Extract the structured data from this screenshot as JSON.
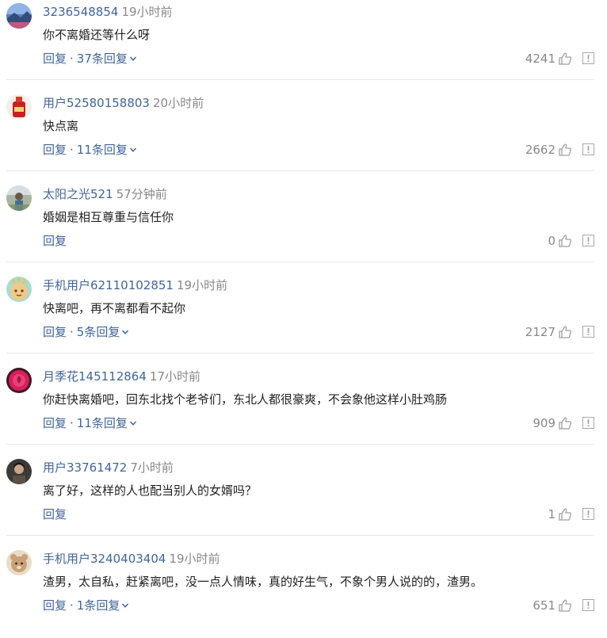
{
  "comments": [
    {
      "username": "3236548854",
      "time": "19小时前",
      "content": "你不离婚还等什么呀",
      "reply_label": "回复",
      "replies_label": "37条回复",
      "likes": "4241",
      "avatar": "landscape-avatar"
    },
    {
      "username": "用户52580158803",
      "time": "20小时前",
      "content": "快点离",
      "reply_label": "回复",
      "replies_label": "11条回复",
      "likes": "2662",
      "avatar": "red-bottle-avatar"
    },
    {
      "username": "太阳之光521",
      "time": "57分钟前",
      "content": "婚姻是相互尊重与信任你",
      "reply_label": "回复",
      "replies_label": "",
      "likes": "0",
      "avatar": "outdoor-photo-avatar"
    },
    {
      "username": "手机用户62110102851",
      "time": "19小时前",
      "content": "快离吧，再不离都看不起你",
      "reply_label": "回复",
      "replies_label": "5条回复",
      "likes": "2127",
      "avatar": "default-teal-avatar"
    },
    {
      "username": "月季花145112864",
      "time": "17小时前",
      "content": "你赶快离婚吧，回东北找个老爷们，东北人都很豪爽，不会象他这样小肚鸡肠",
      "reply_label": "回复",
      "replies_label": "11条回复",
      "likes": "909",
      "avatar": "rose-avatar"
    },
    {
      "username": "用户33761472",
      "time": "7小时前",
      "content": "离了好，这样的人也配当别人的女婿吗？",
      "reply_label": "回复",
      "replies_label": "",
      "likes": "1",
      "avatar": "portrait-photo-avatar"
    },
    {
      "username": "手机用户3240403404",
      "time": "19小时前",
      "content": "渣男，太自私，赶紧离吧，没一点人情味，真的好生气，不象个男人说的的，渣男。",
      "reply_label": "回复",
      "replies_label": "1条回复",
      "likes": "651",
      "avatar": "default-tan-avatar"
    }
  ],
  "icons": {
    "like": "thumbs-up-icon",
    "report": "report-icon",
    "expand": "chevron-down-icon"
  },
  "colors": {
    "link": "#406599",
    "muted": "#888888",
    "text": "#222222",
    "divider": "#e8e8e8"
  }
}
